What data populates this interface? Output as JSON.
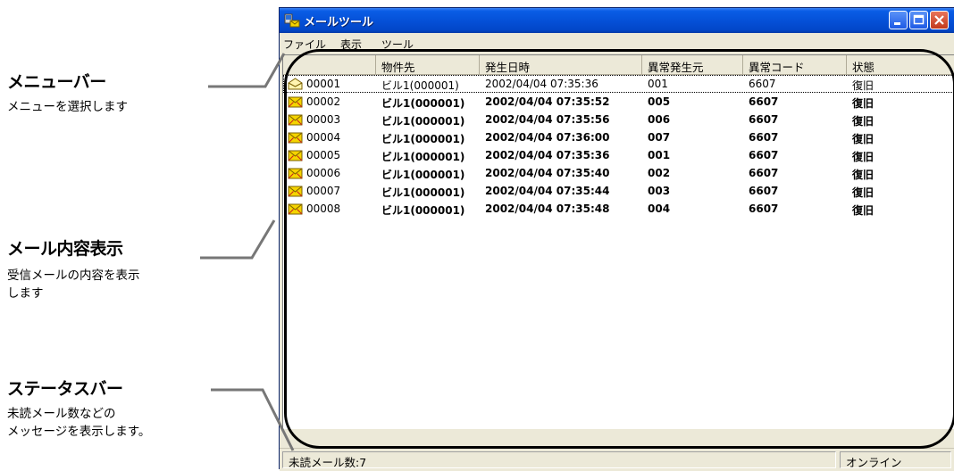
{
  "annotations": [
    {
      "title": "メニューバー",
      "desc": [
        "メニューを選択します"
      ]
    },
    {
      "title": "メール内容表示",
      "desc": [
        "受信メールの内容を表示",
        "します"
      ]
    },
    {
      "title": "ステータスバー",
      "desc": [
        "未読メール数などの",
        "メッセージを表示します。"
      ]
    }
  ],
  "window": {
    "title": "メールツール",
    "icon": "mail-tool-app-icon"
  },
  "menu": [
    "ファイル",
    "表示",
    "ツール"
  ],
  "columns": [
    "",
    "物件先",
    "発生日時",
    "異常発生元",
    "異常コード",
    "状態"
  ],
  "rows": [
    {
      "id": "00001",
      "site": "ビル1(000001)",
      "datetime": "2002/04/04 07:35:36",
      "source": "001",
      "code": "6607",
      "status": "復旧",
      "read": true
    },
    {
      "id": "00002",
      "site": "ビル1(000001)",
      "datetime": "2002/04/04 07:35:52",
      "source": "005",
      "code": "6607",
      "status": "復旧",
      "read": false
    },
    {
      "id": "00003",
      "site": "ビル1(000001)",
      "datetime": "2002/04/04 07:35:56",
      "source": "006",
      "code": "6607",
      "status": "復旧",
      "read": false
    },
    {
      "id": "00004",
      "site": "ビル1(000001)",
      "datetime": "2002/04/04 07:36:00",
      "source": "007",
      "code": "6607",
      "status": "復旧",
      "read": false
    },
    {
      "id": "00005",
      "site": "ビル1(000001)",
      "datetime": "2002/04/04 07:35:36",
      "source": "001",
      "code": "6607",
      "status": "復旧",
      "read": false
    },
    {
      "id": "00006",
      "site": "ビル1(000001)",
      "datetime": "2002/04/04 07:35:40",
      "source": "002",
      "code": "6607",
      "status": "復旧",
      "read": false
    },
    {
      "id": "00007",
      "site": "ビル1(000001)",
      "datetime": "2002/04/04 07:35:44",
      "source": "003",
      "code": "6607",
      "status": "復旧",
      "read": false
    },
    {
      "id": "00008",
      "site": "ビル1(000001)",
      "datetime": "2002/04/04 07:35:48",
      "source": "004",
      "code": "6607",
      "status": "復旧",
      "read": false
    }
  ],
  "status": {
    "unread": "未読メール数:7",
    "connection": "オンライン"
  },
  "colors": {
    "titlebar": "#0551d8",
    "envelope_unread": "#f5d400",
    "envelope_read": "#fff5b0"
  }
}
